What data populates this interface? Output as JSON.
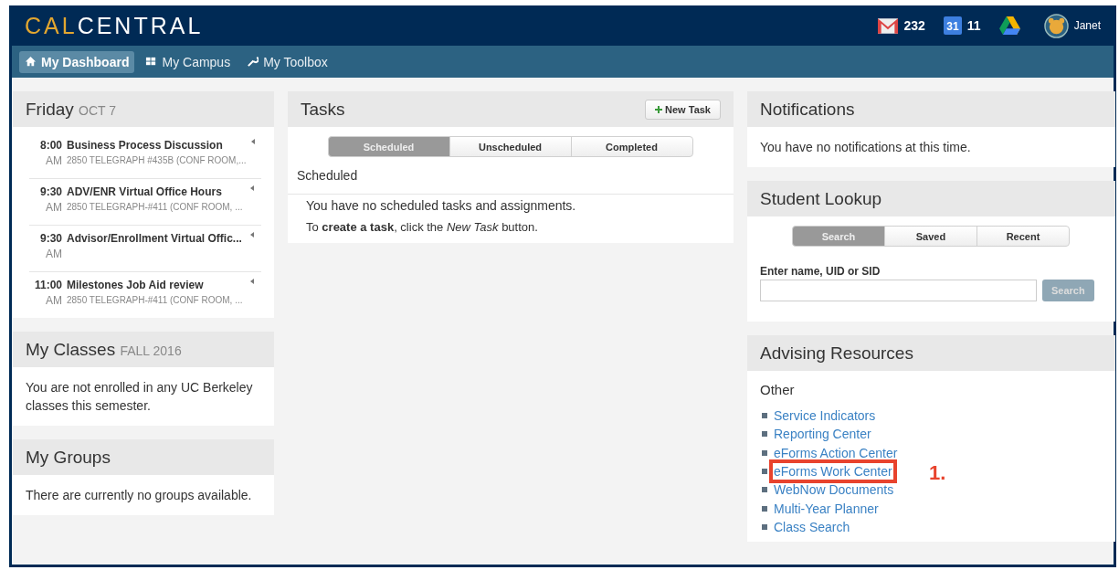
{
  "header": {
    "logo": [
      "CAL",
      "CENTRAL"
    ],
    "mail_count": "232",
    "calendar_day": "31",
    "calendar_count": "11",
    "user": "Janet"
  },
  "nav": [
    {
      "label": "My Dashboard",
      "kind": "home",
      "selected": true
    },
    {
      "label": "My Campus",
      "kind": "grid",
      "selected": false
    },
    {
      "label": "My Toolbox",
      "kind": "tools",
      "selected": false
    }
  ],
  "day_panel": {
    "title": "Friday",
    "date": "OCT 7",
    "events": [
      {
        "time": "8:00",
        "meridiem": "AM",
        "title": "Business Process Discussion",
        "location": "2850 TELEGRAPH #435B (CONF ROOM,..."
      },
      {
        "time": "9:30",
        "meridiem": "AM",
        "title": "ADV/ENR Virtual Office Hours",
        "location": "2850 TELEGRAPH-#411 (CONF ROOM, ..."
      },
      {
        "time": "9:30",
        "meridiem": "AM",
        "title": "Advisor/Enrollment Virtual Offic..."
      },
      {
        "time": "11:00",
        "meridiem": "AM",
        "title": "Milestones Job Aid review",
        "location": "2850 TELEGRAPH-#411 (CONF ROOM, ..."
      }
    ]
  },
  "classes_panel": {
    "title": "My Classes",
    "term": "FALL 2016",
    "message": "You are not enrolled in any UC Berkeley classes this semester."
  },
  "groups_panel": {
    "title": "My Groups",
    "message": "There are currently no groups available."
  },
  "tasks_panel": {
    "title": "Tasks",
    "new_button": "New Task",
    "tabs": [
      {
        "label": "Scheduled",
        "selected": true
      },
      {
        "label": "Unscheduled",
        "selected": false
      },
      {
        "label": "Completed",
        "selected": false
      }
    ],
    "section": "Scheduled",
    "message": "You have no scheduled tasks and assignments.",
    "hint": "To **create a task**, click the *New Task* button."
  },
  "notifications_panel": {
    "title": "Notifications",
    "message": "You have no notifications at this time."
  },
  "lookup_panel": {
    "title": "Student Lookup",
    "tabs": [
      {
        "label": "Search",
        "selected": true
      },
      {
        "label": "Saved",
        "selected": false
      },
      {
        "label": "Recent",
        "selected": false
      }
    ],
    "field_label": "Enter name, UID or SID",
    "search_button": "Search",
    "search_disabled": true
  },
  "resources_panel": {
    "title": "Advising Resources",
    "section": "Other",
    "links": [
      {
        "label": "Service Indicators",
        "highlighted": false
      },
      {
        "label": "Reporting Center",
        "highlighted": false
      },
      {
        "label": "eForms Action Center",
        "highlighted": false
      },
      {
        "label": "eForms Work Center",
        "highlighted": true,
        "callout": "1."
      },
      {
        "label": "WebNow Documents",
        "highlighted": false
      },
      {
        "label": "Multi-Year Planner",
        "highlighted": false
      },
      {
        "label": "Class Search",
        "highlighted": false
      }
    ]
  }
}
